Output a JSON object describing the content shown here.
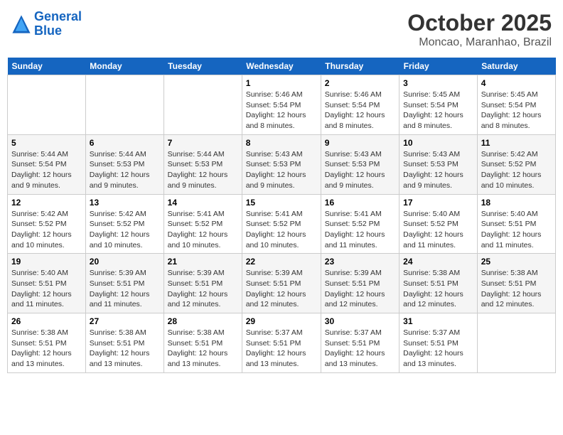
{
  "header": {
    "logo_line1": "General",
    "logo_line2": "Blue",
    "month": "October 2025",
    "location": "Moncao, Maranhao, Brazil"
  },
  "weekdays": [
    "Sunday",
    "Monday",
    "Tuesday",
    "Wednesday",
    "Thursday",
    "Friday",
    "Saturday"
  ],
  "weeks": [
    [
      {
        "day": "",
        "sunrise": "",
        "sunset": "",
        "daylight": ""
      },
      {
        "day": "",
        "sunrise": "",
        "sunset": "",
        "daylight": ""
      },
      {
        "day": "",
        "sunrise": "",
        "sunset": "",
        "daylight": ""
      },
      {
        "day": "1",
        "sunrise": "Sunrise: 5:46 AM",
        "sunset": "Sunset: 5:54 PM",
        "daylight": "Daylight: 12 hours and 8 minutes."
      },
      {
        "day": "2",
        "sunrise": "Sunrise: 5:46 AM",
        "sunset": "Sunset: 5:54 PM",
        "daylight": "Daylight: 12 hours and 8 minutes."
      },
      {
        "day": "3",
        "sunrise": "Sunrise: 5:45 AM",
        "sunset": "Sunset: 5:54 PM",
        "daylight": "Daylight: 12 hours and 8 minutes."
      },
      {
        "day": "4",
        "sunrise": "Sunrise: 5:45 AM",
        "sunset": "Sunset: 5:54 PM",
        "daylight": "Daylight: 12 hours and 8 minutes."
      }
    ],
    [
      {
        "day": "5",
        "sunrise": "Sunrise: 5:44 AM",
        "sunset": "Sunset: 5:54 PM",
        "daylight": "Daylight: 12 hours and 9 minutes."
      },
      {
        "day": "6",
        "sunrise": "Sunrise: 5:44 AM",
        "sunset": "Sunset: 5:53 PM",
        "daylight": "Daylight: 12 hours and 9 minutes."
      },
      {
        "day": "7",
        "sunrise": "Sunrise: 5:44 AM",
        "sunset": "Sunset: 5:53 PM",
        "daylight": "Daylight: 12 hours and 9 minutes."
      },
      {
        "day": "8",
        "sunrise": "Sunrise: 5:43 AM",
        "sunset": "Sunset: 5:53 PM",
        "daylight": "Daylight: 12 hours and 9 minutes."
      },
      {
        "day": "9",
        "sunrise": "Sunrise: 5:43 AM",
        "sunset": "Sunset: 5:53 PM",
        "daylight": "Daylight: 12 hours and 9 minutes."
      },
      {
        "day": "10",
        "sunrise": "Sunrise: 5:43 AM",
        "sunset": "Sunset: 5:53 PM",
        "daylight": "Daylight: 12 hours and 9 minutes."
      },
      {
        "day": "11",
        "sunrise": "Sunrise: 5:42 AM",
        "sunset": "Sunset: 5:52 PM",
        "daylight": "Daylight: 12 hours and 10 minutes."
      }
    ],
    [
      {
        "day": "12",
        "sunrise": "Sunrise: 5:42 AM",
        "sunset": "Sunset: 5:52 PM",
        "daylight": "Daylight: 12 hours and 10 minutes."
      },
      {
        "day": "13",
        "sunrise": "Sunrise: 5:42 AM",
        "sunset": "Sunset: 5:52 PM",
        "daylight": "Daylight: 12 hours and 10 minutes."
      },
      {
        "day": "14",
        "sunrise": "Sunrise: 5:41 AM",
        "sunset": "Sunset: 5:52 PM",
        "daylight": "Daylight: 12 hours and 10 minutes."
      },
      {
        "day": "15",
        "sunrise": "Sunrise: 5:41 AM",
        "sunset": "Sunset: 5:52 PM",
        "daylight": "Daylight: 12 hours and 10 minutes."
      },
      {
        "day": "16",
        "sunrise": "Sunrise: 5:41 AM",
        "sunset": "Sunset: 5:52 PM",
        "daylight": "Daylight: 12 hours and 11 minutes."
      },
      {
        "day": "17",
        "sunrise": "Sunrise: 5:40 AM",
        "sunset": "Sunset: 5:52 PM",
        "daylight": "Daylight: 12 hours and 11 minutes."
      },
      {
        "day": "18",
        "sunrise": "Sunrise: 5:40 AM",
        "sunset": "Sunset: 5:51 PM",
        "daylight": "Daylight: 12 hours and 11 minutes."
      }
    ],
    [
      {
        "day": "19",
        "sunrise": "Sunrise: 5:40 AM",
        "sunset": "Sunset: 5:51 PM",
        "daylight": "Daylight: 12 hours and 11 minutes."
      },
      {
        "day": "20",
        "sunrise": "Sunrise: 5:39 AM",
        "sunset": "Sunset: 5:51 PM",
        "daylight": "Daylight: 12 hours and 11 minutes."
      },
      {
        "day": "21",
        "sunrise": "Sunrise: 5:39 AM",
        "sunset": "Sunset: 5:51 PM",
        "daylight": "Daylight: 12 hours and 12 minutes."
      },
      {
        "day": "22",
        "sunrise": "Sunrise: 5:39 AM",
        "sunset": "Sunset: 5:51 PM",
        "daylight": "Daylight: 12 hours and 12 minutes."
      },
      {
        "day": "23",
        "sunrise": "Sunrise: 5:39 AM",
        "sunset": "Sunset: 5:51 PM",
        "daylight": "Daylight: 12 hours and 12 minutes."
      },
      {
        "day": "24",
        "sunrise": "Sunrise: 5:38 AM",
        "sunset": "Sunset: 5:51 PM",
        "daylight": "Daylight: 12 hours and 12 minutes."
      },
      {
        "day": "25",
        "sunrise": "Sunrise: 5:38 AM",
        "sunset": "Sunset: 5:51 PM",
        "daylight": "Daylight: 12 hours and 12 minutes."
      }
    ],
    [
      {
        "day": "26",
        "sunrise": "Sunrise: 5:38 AM",
        "sunset": "Sunset: 5:51 PM",
        "daylight": "Daylight: 12 hours and 13 minutes."
      },
      {
        "day": "27",
        "sunrise": "Sunrise: 5:38 AM",
        "sunset": "Sunset: 5:51 PM",
        "daylight": "Daylight: 12 hours and 13 minutes."
      },
      {
        "day": "28",
        "sunrise": "Sunrise: 5:38 AM",
        "sunset": "Sunset: 5:51 PM",
        "daylight": "Daylight: 12 hours and 13 minutes."
      },
      {
        "day": "29",
        "sunrise": "Sunrise: 5:37 AM",
        "sunset": "Sunset: 5:51 PM",
        "daylight": "Daylight: 12 hours and 13 minutes."
      },
      {
        "day": "30",
        "sunrise": "Sunrise: 5:37 AM",
        "sunset": "Sunset: 5:51 PM",
        "daylight": "Daylight: 12 hours and 13 minutes."
      },
      {
        "day": "31",
        "sunrise": "Sunrise: 5:37 AM",
        "sunset": "Sunset: 5:51 PM",
        "daylight": "Daylight: 12 hours and 13 minutes."
      },
      {
        "day": "",
        "sunrise": "",
        "sunset": "",
        "daylight": ""
      }
    ]
  ]
}
